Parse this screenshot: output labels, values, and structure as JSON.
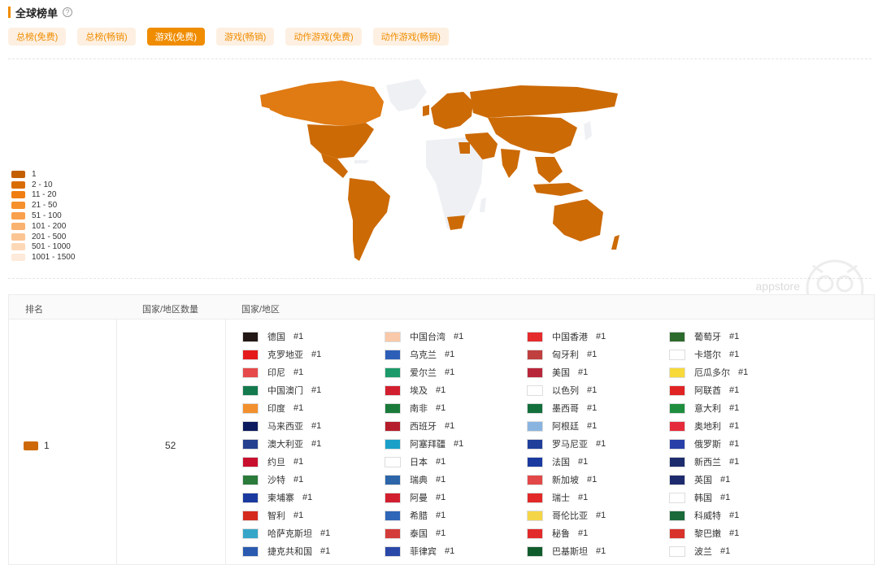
{
  "header": {
    "title": "全球榜单",
    "help": "?"
  },
  "tabs": [
    {
      "label": "总榜(免费)",
      "active": false
    },
    {
      "label": "总榜(畅销)",
      "active": false
    },
    {
      "label": "游戏(免费)",
      "active": true
    },
    {
      "label": "游戏(畅销)",
      "active": false
    },
    {
      "label": "动作游戏(免费)",
      "active": false
    },
    {
      "label": "动作游戏(畅销)",
      "active": false
    }
  ],
  "legend": [
    {
      "label": "1",
      "color": "#c45f00"
    },
    {
      "label": "2 - 10",
      "color": "#d96d05"
    },
    {
      "label": "11 - 20",
      "color": "#f07e12"
    },
    {
      "label": "21 - 50",
      "color": "#f6902e"
    },
    {
      "label": "51 - 100",
      "color": "#f8a04c"
    },
    {
      "label": "101 - 200",
      "color": "#f9b26f"
    },
    {
      "label": "201 - 500",
      "color": "#fbc593"
    },
    {
      "label": "501 - 1000",
      "color": "#fdd8b7"
    },
    {
      "label": "1001 - 1500",
      "color": "#feeada"
    }
  ],
  "watermark": {
    "text": "appstore"
  },
  "table": {
    "headers": {
      "rank": "排名",
      "count": "国家/地区数量",
      "regions": "国家/地区"
    },
    "row": {
      "rank": "1",
      "count": "52"
    },
    "countries": [
      {
        "name": "德国",
        "rank": "#1",
        "flag": "#231815"
      },
      {
        "name": "中国台湾",
        "rank": "#1",
        "flag": "#f9c9a9"
      },
      {
        "name": "中国香港",
        "rank": "#1",
        "flag": "#e52b2b"
      },
      {
        "name": "葡萄牙",
        "rank": "#1",
        "flag": "#2d6a2d"
      },
      {
        "name": "克罗地亚",
        "rank": "#1",
        "flag": "#e51b1b"
      },
      {
        "name": "乌克兰",
        "rank": "#1",
        "flag": "#2e5fb8"
      },
      {
        "name": "匈牙利",
        "rank": "#1",
        "flag": "#c04040"
      },
      {
        "name": "卡塔尔",
        "rank": "#1",
        "flag": "#ffffff"
      },
      {
        "name": "印尼",
        "rank": "#1",
        "flag": "#e64a4a"
      },
      {
        "name": "爱尔兰",
        "rank": "#1",
        "flag": "#1c9a6a"
      },
      {
        "name": "美国",
        "rank": "#1",
        "flag": "#b8263a"
      },
      {
        "name": "厄瓜多尔",
        "rank": "#1",
        "flag": "#f7d93a"
      },
      {
        "name": "中国澳门",
        "rank": "#1",
        "flag": "#137a4e"
      },
      {
        "name": "埃及",
        "rank": "#1",
        "flag": "#d21f2f"
      },
      {
        "name": "以色列",
        "rank": "#1",
        "flag": "#ffffff"
      },
      {
        "name": "阿联酋",
        "rank": "#1",
        "flag": "#e02323"
      },
      {
        "name": "印度",
        "rank": "#1",
        "flag": "#f2902e"
      },
      {
        "name": "南非",
        "rank": "#1",
        "flag": "#1a7a3a"
      },
      {
        "name": "墨西哥",
        "rank": "#1",
        "flag": "#13703c"
      },
      {
        "name": "意大利",
        "rank": "#1",
        "flag": "#1e8e3e"
      },
      {
        "name": "马来西亚",
        "rank": "#1",
        "flag": "#0c1a5e"
      },
      {
        "name": "西班牙",
        "rank": "#1",
        "flag": "#b51d2a"
      },
      {
        "name": "阿根廷",
        "rank": "#1",
        "flag": "#8ab4e0"
      },
      {
        "name": "奥地利",
        "rank": "#1",
        "flag": "#e52b3b"
      },
      {
        "name": "澳大利亚",
        "rank": "#1",
        "flag": "#24408e"
      },
      {
        "name": "阿塞拜疆",
        "rank": "#1",
        "flag": "#1aa0c8"
      },
      {
        "name": "罗马尼亚",
        "rank": "#1",
        "flag": "#1f3f9a"
      },
      {
        "name": "俄罗斯",
        "rank": "#1",
        "flag": "#2940a8"
      },
      {
        "name": "约旦",
        "rank": "#1",
        "flag": "#c8102e"
      },
      {
        "name": "日本",
        "rank": "#1",
        "flag": "#ffffff"
      },
      {
        "name": "法国",
        "rank": "#1",
        "flag": "#1b3aa0"
      },
      {
        "name": "新西兰",
        "rank": "#1",
        "flag": "#1c2c6c"
      },
      {
        "name": "沙特",
        "rank": "#1",
        "flag": "#2a7a3a"
      },
      {
        "name": "瑞典",
        "rank": "#1",
        "flag": "#2c65a8"
      },
      {
        "name": "新加坡",
        "rank": "#1",
        "flag": "#e24848"
      },
      {
        "name": "英国",
        "rank": "#1",
        "flag": "#1e2a6e"
      },
      {
        "name": "柬埔寨",
        "rank": "#1",
        "flag": "#1b3aa0"
      },
      {
        "name": "阿曼",
        "rank": "#1",
        "flag": "#d21f2f"
      },
      {
        "name": "瑞士",
        "rank": "#1",
        "flag": "#e22828"
      },
      {
        "name": "韩国",
        "rank": "#1",
        "flag": "#ffffff"
      },
      {
        "name": "智利",
        "rank": "#1",
        "flag": "#d52b1e"
      },
      {
        "name": "希腊",
        "rank": "#1",
        "flag": "#2f66b8"
      },
      {
        "name": "哥伦比亚",
        "rank": "#1",
        "flag": "#f5d548"
      },
      {
        "name": "科威特",
        "rank": "#1",
        "flag": "#1a6a3a"
      },
      {
        "name": "哈萨克斯坦",
        "rank": "#1",
        "flag": "#36a6c8"
      },
      {
        "name": "泰国",
        "rank": "#1",
        "flag": "#d43b3b"
      },
      {
        "name": "秘鲁",
        "rank": "#1",
        "flag": "#e22a2a"
      },
      {
        "name": "黎巴嫩",
        "rank": "#1",
        "flag": "#d8322a"
      },
      {
        "name": "捷克共和国",
        "rank": "#1",
        "flag": "#2a5ab0"
      },
      {
        "name": "菲律宾",
        "rank": "#1",
        "flag": "#2a48a8"
      },
      {
        "name": "巴基斯坦",
        "rank": "#1",
        "flag": "#115c2c"
      },
      {
        "name": "波兰",
        "rank": "#1",
        "flag": "#ffffff"
      }
    ]
  },
  "map": {
    "ocean": "#ffffff",
    "rank1_color": "#cc6a06",
    "rank2_color": "#e07a12",
    "nodata_color": "#eef0f4"
  }
}
